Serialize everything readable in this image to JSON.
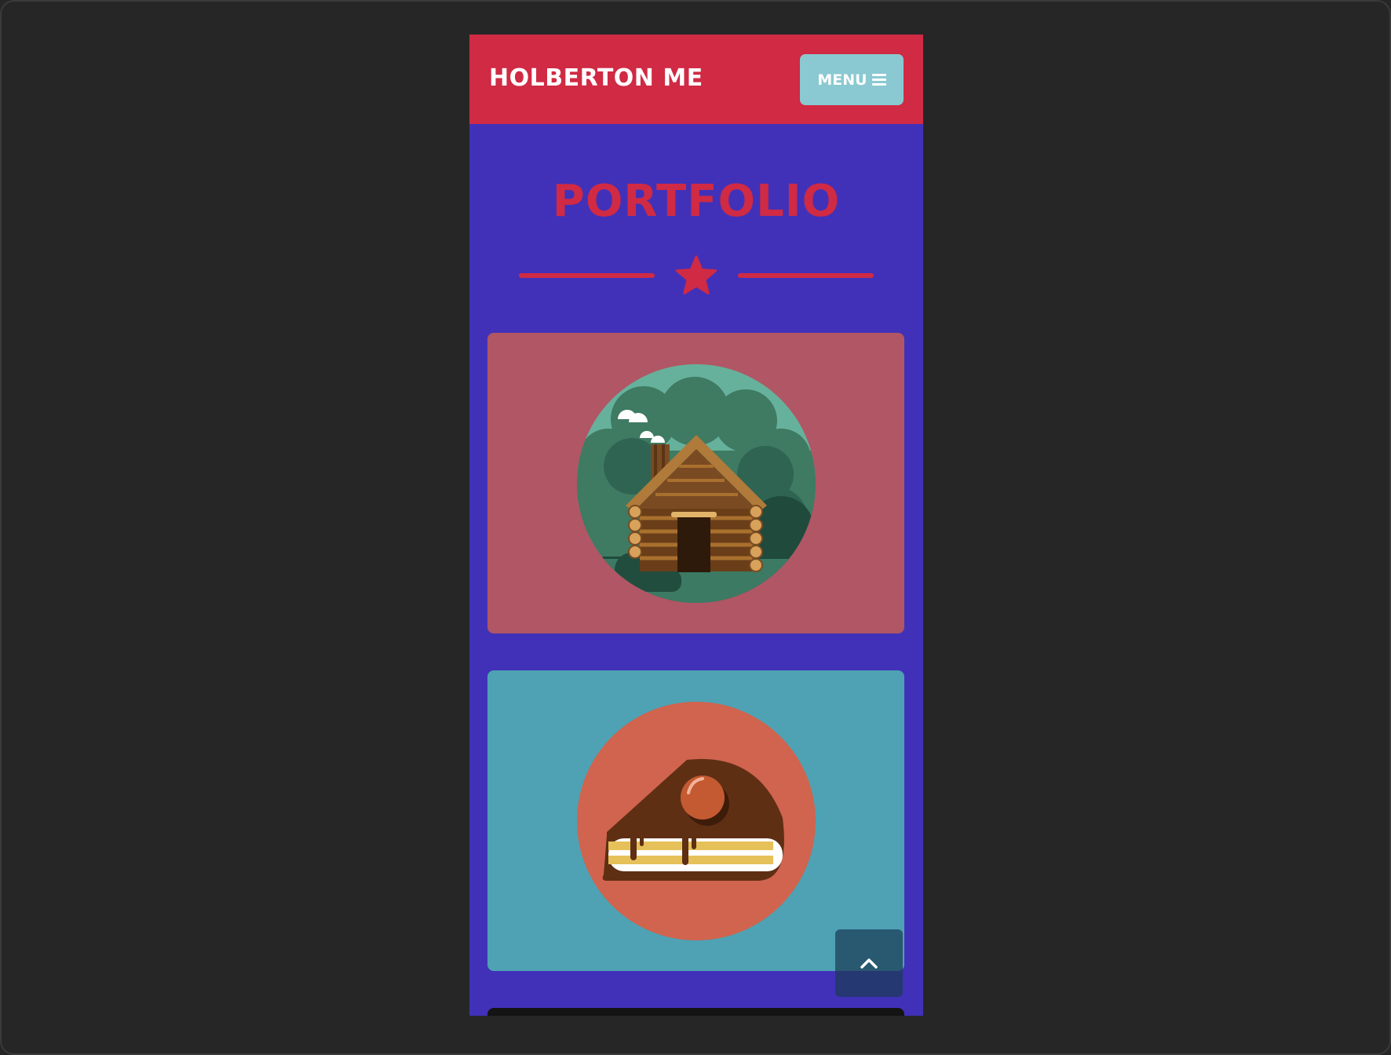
{
  "navbar": {
    "brand": "HOLBERTON ME",
    "menu_label": "MENU",
    "menu_icon": "hamburger-icon"
  },
  "portfolio": {
    "title": "PORTFOLIO",
    "divider_icon": "star-icon",
    "items": [
      {
        "illustration": "log-cabin-icon"
      },
      {
        "illustration": "cake-slice-icon"
      },
      {
        "illustration": ""
      }
    ]
  },
  "back_to_top": {
    "icon": "chevron-up-icon"
  },
  "colors": {
    "navbar": "#d02a44",
    "background": "#4131b8",
    "menu_button": "#8ac9d1",
    "title": "#d02a44",
    "card_1": "#b05664",
    "card_2": "#4ea2b4",
    "page_frame": "#262626"
  }
}
